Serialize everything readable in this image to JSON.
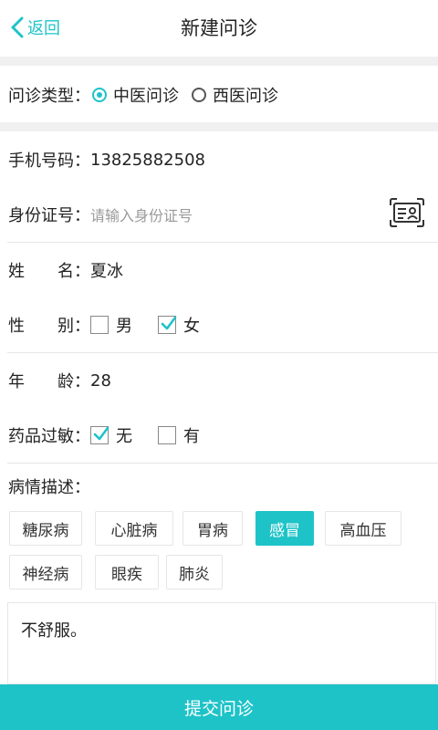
{
  "header": {
    "back_label": "返回",
    "title": "新建问诊"
  },
  "consult_type": {
    "label": "问诊类型：",
    "options": [
      {
        "label": "中医问诊",
        "selected": true
      },
      {
        "label": "西医问诊",
        "selected": false
      }
    ]
  },
  "phone": {
    "label": "手机号码：",
    "value": "13825882508"
  },
  "id_number": {
    "label": "身份证号：",
    "placeholder": "请输入身份证号",
    "icon": "id-card-scan-icon"
  },
  "name": {
    "label": "姓　　名：",
    "value": "夏冰"
  },
  "gender": {
    "label": "性　　别：",
    "options": [
      {
        "label": "男",
        "checked": false
      },
      {
        "label": "女",
        "checked": true
      }
    ]
  },
  "age": {
    "label": "年　　龄：",
    "value": "28"
  },
  "allergy": {
    "label": "药品过敏：",
    "options": [
      {
        "label": "无",
        "checked": true
      },
      {
        "label": "有",
        "checked": false
      }
    ]
  },
  "condition": {
    "label": "病情描述：",
    "tags": [
      {
        "label": "糖尿病",
        "selected": false
      },
      {
        "label": "心脏病",
        "selected": false
      },
      {
        "label": "胃病",
        "selected": false
      },
      {
        "label": "感冒",
        "selected": true
      },
      {
        "label": "高血压",
        "selected": false
      },
      {
        "label": "神经病",
        "selected": false
      },
      {
        "label": "眼疾",
        "selected": false
      },
      {
        "label": "肺炎",
        "selected": false
      }
    ],
    "description": "不舒服。"
  },
  "submit_label": "提交问诊",
  "colors": {
    "accent": "#1ec3c8",
    "divider": "#e6e6e6",
    "section_gap": "#f0f0f0"
  }
}
